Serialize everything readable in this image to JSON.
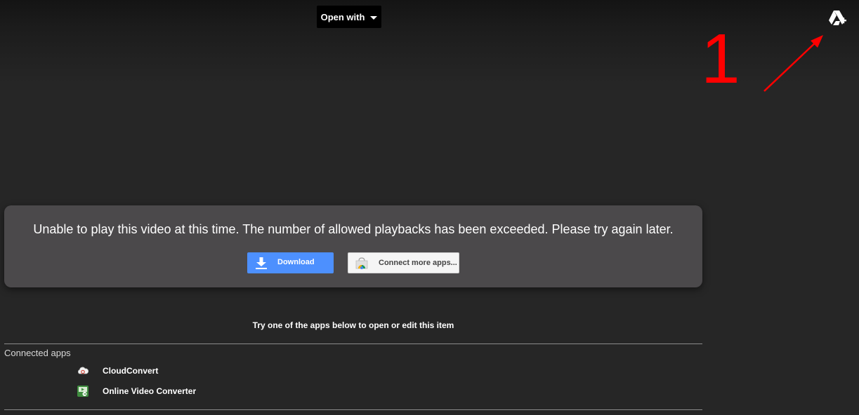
{
  "toolbar": {
    "open_with_label": "Open with",
    "caret_icon": "chevron-down-icon",
    "drive_add_icon": "add-to-drive-icon"
  },
  "annotation": {
    "number": "1",
    "color": "#ff0000"
  },
  "error_card": {
    "message": "Unable to play this video at this time. The number of allowed playbacks has been exceeded. Please try again later.",
    "download_label": "Download",
    "download_icon": "download-icon",
    "connect_label": "Connect more apps...",
    "connect_icon": "chrome-web-store-icon",
    "download_color": "#4d90fe"
  },
  "apps_section": {
    "prompt": "Try one of the apps below to open or edit this item",
    "title": "Connected apps",
    "apps": [
      {
        "name": "CloudConvert",
        "icon": "cloud-icon"
      },
      {
        "name": "Online Video Converter",
        "icon": "video-converter-icon"
      }
    ]
  }
}
